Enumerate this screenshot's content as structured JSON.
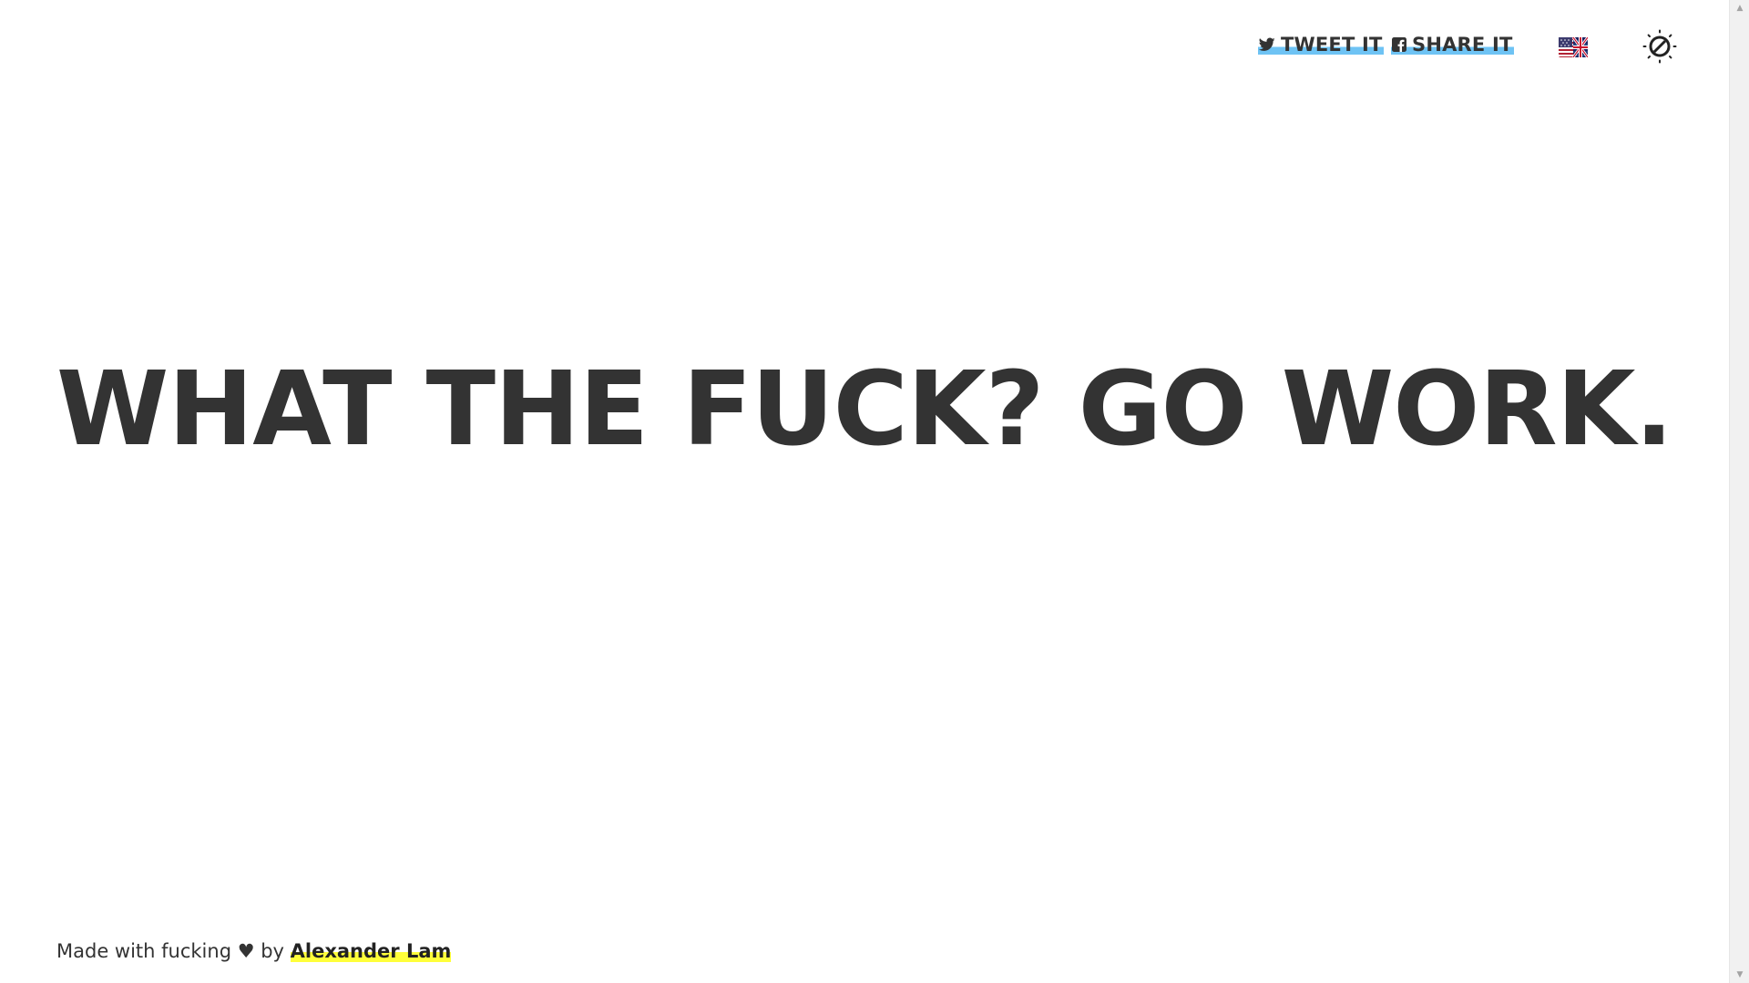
{
  "header": {
    "tweet_label": "TWEET IT",
    "share_label": "SHARE IT",
    "icons": {
      "tweet": "twitter-icon",
      "share": "facebook-icon",
      "language": "us-uk-flag-icon",
      "theme": "theme-toggle-icon"
    }
  },
  "main": {
    "headline": "WHAT THE FUCK? GO WORK."
  },
  "footer": {
    "prefix": "Made with fucking ♥ by ",
    "author": "Alexander Lam"
  },
  "colors": {
    "text": "#333333",
    "tweet_highlight": "#6ec3f4",
    "author_highlight": "#ffff3a",
    "background": "#ffffff"
  }
}
